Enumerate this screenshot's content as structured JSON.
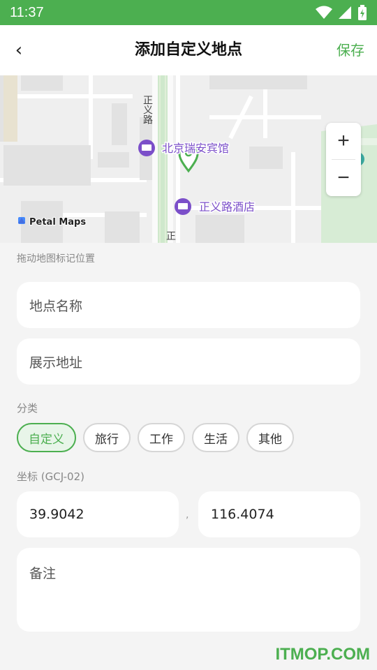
{
  "status_bar": {
    "time": "11:37",
    "icons": [
      "wifi-icon",
      "signal-icon",
      "battery-icon"
    ]
  },
  "app_bar": {
    "back_icon": "chevron-left-icon",
    "back_glyph": "‹",
    "title": "添加自定义地点",
    "save_label": "保存"
  },
  "map": {
    "road_label_1": "正义路",
    "road_label_2": "正",
    "poi_1": "北京瑞安宾馆",
    "poi_2": "正义路酒店",
    "attribution": "Petal Maps",
    "zoom_in": "+",
    "zoom_out": "−"
  },
  "form": {
    "hint": "拖动地图标记位置",
    "name_placeholder": "地点名称",
    "address_placeholder": "展示地址",
    "category_label": "分类",
    "categories": [
      {
        "label": "自定义",
        "active": true
      },
      {
        "label": "旅行",
        "active": false
      },
      {
        "label": "工作",
        "active": false
      },
      {
        "label": "生活",
        "active": false
      },
      {
        "label": "其他",
        "active": false
      }
    ],
    "coord_label": "坐标 (GCJ-02)",
    "latitude": "39.9042",
    "separator": ",",
    "longitude": "116.4074",
    "note_placeholder": "备注"
  },
  "watermark": "ITMOP.COM",
  "colors": {
    "accent": "#4caf50",
    "poi": "#7b4fc9"
  }
}
